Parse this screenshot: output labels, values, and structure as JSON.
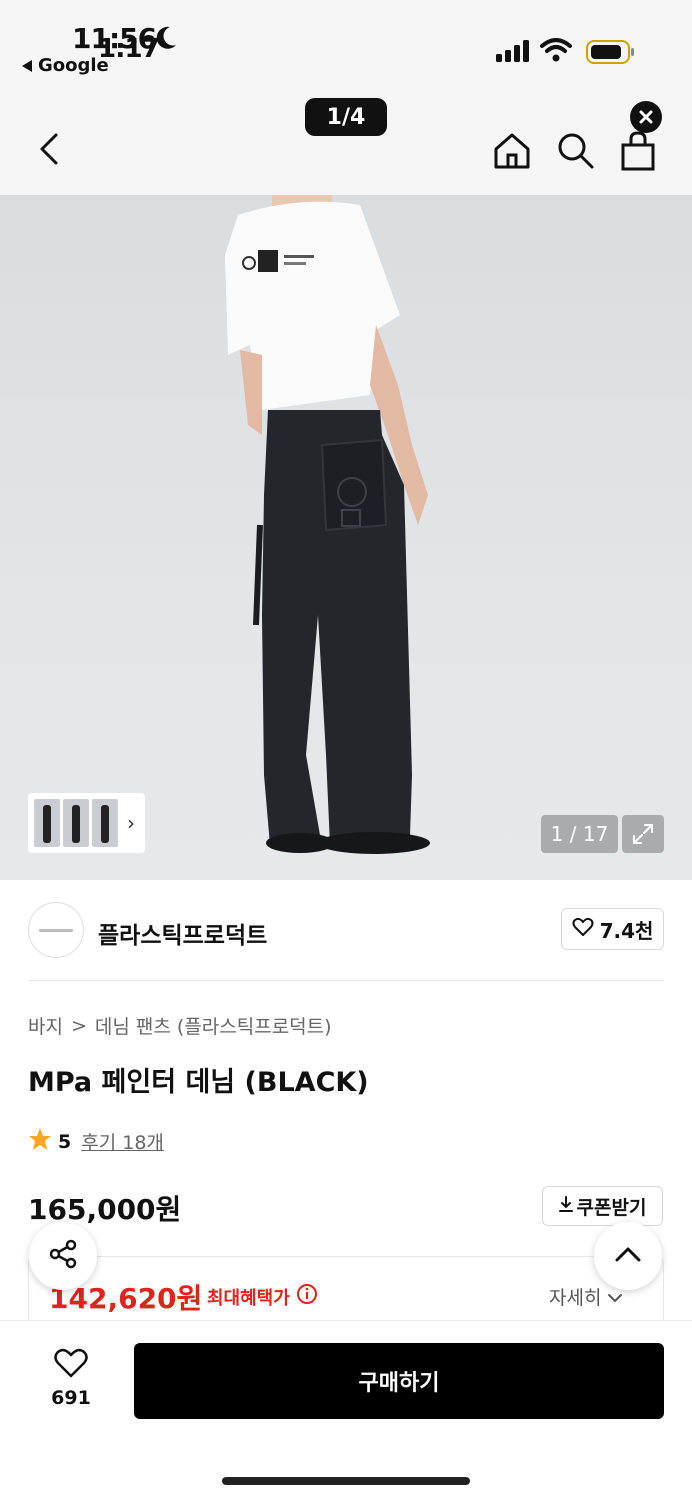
{
  "status_bar": {
    "time_primary": "11:56",
    "time_overlay": "1:17",
    "back_app": "Google",
    "icons": [
      "moon-icon",
      "signal-icon",
      "wifi-icon",
      "battery-icon"
    ]
  },
  "nav": {
    "page_indicator": "1/4",
    "icons": [
      "back-chevron-icon",
      "home-icon",
      "search-icon",
      "shopping-bag-icon",
      "close-icon"
    ]
  },
  "gallery": {
    "counter": "1 / 17",
    "thumb_chevron": "›"
  },
  "brand": {
    "name": "플라스틱프로덕트",
    "likes": "7.4천"
  },
  "breadcrumb": {
    "level1": "바지",
    "separator": ">",
    "level2": "데님 팬츠 (플라스틱프로덕트)"
  },
  "product": {
    "title": "MPa 페인터 데님 (BLACK)",
    "rating": "5",
    "reviews": "후기 18개",
    "price": "165,000원",
    "coupon_label": "쿠폰받기",
    "benefit_price": "142,620원",
    "benefit_label": "최대혜택가",
    "detail_label": "자세히"
  },
  "bottom_bar": {
    "wish_count": "691",
    "buy_label": "구매하기"
  },
  "colors": {
    "accent_red": "#e0231b",
    "star": "#f5a623",
    "buy_button": "#000000"
  }
}
